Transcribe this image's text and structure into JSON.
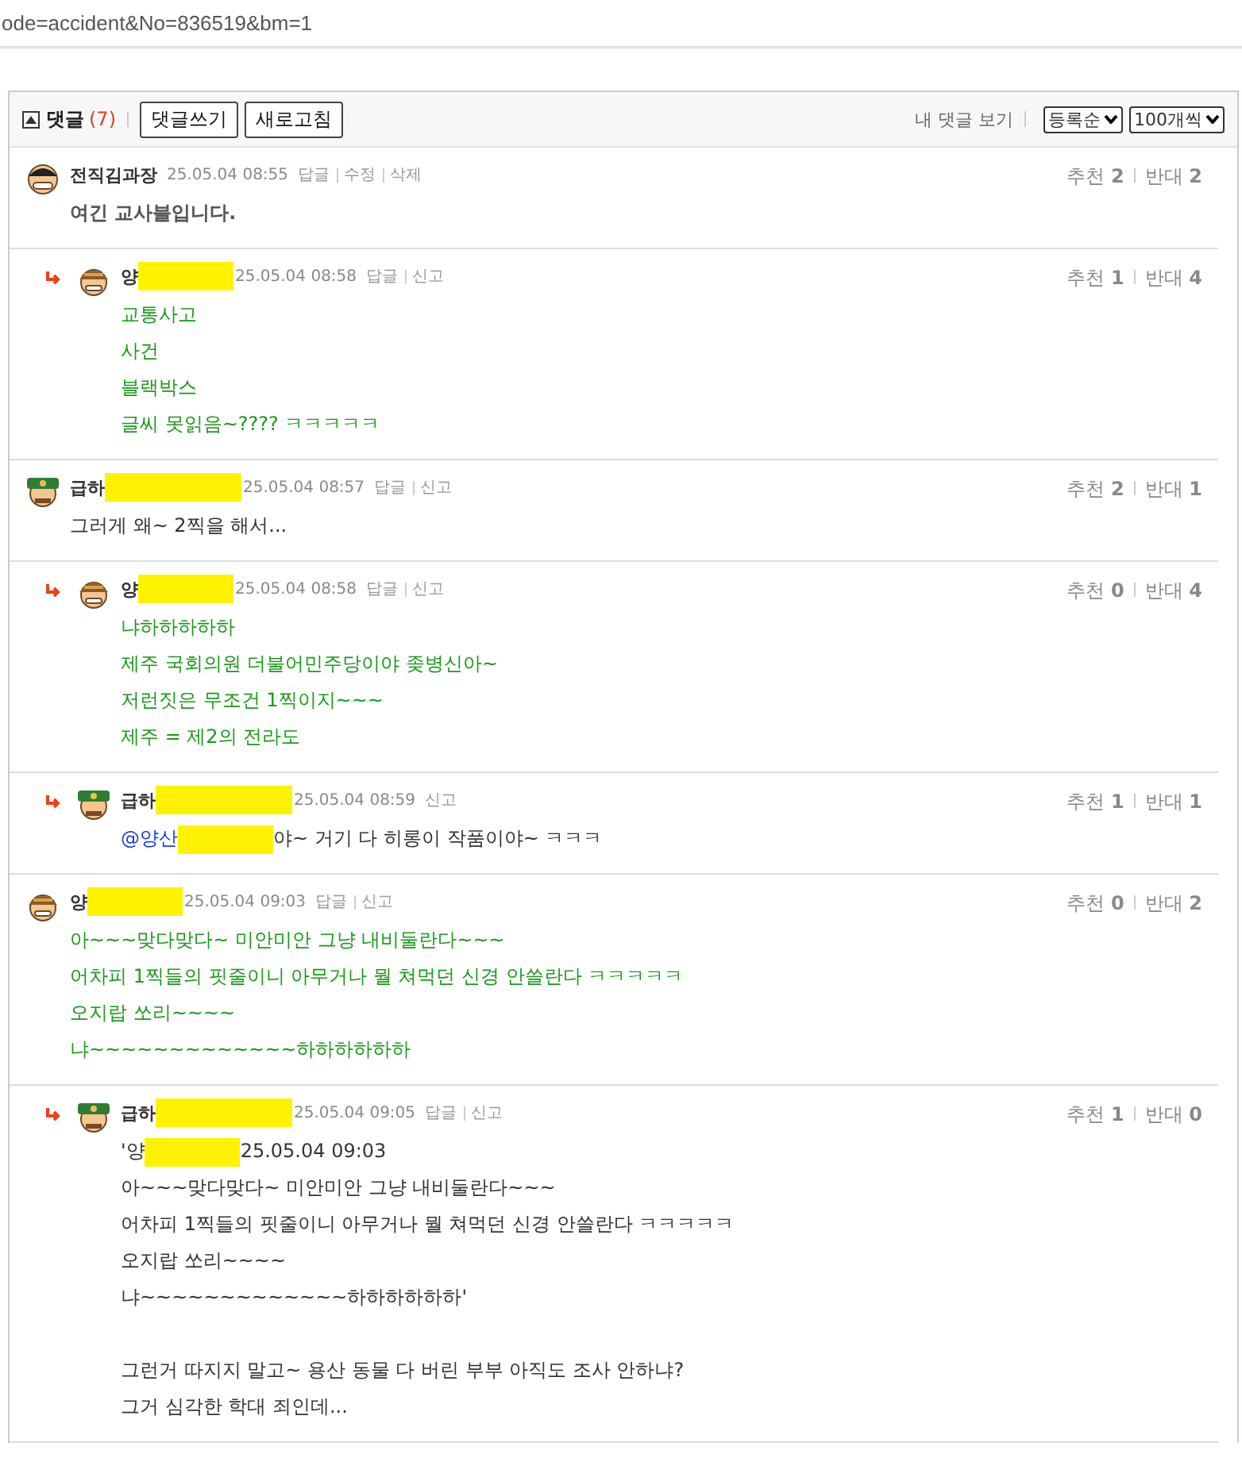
{
  "address_bar": {
    "url": "ode=accident&No=836519&bm=1"
  },
  "comments_header": {
    "title": "댓글",
    "count": "(7)",
    "buttons": [
      "댓글쓰기",
      "새로고침"
    ],
    "my_comments_link": "내 댓글 보기",
    "sort_select": "등록순",
    "page_size_select": "100개씩"
  },
  "comments": [
    {
      "reply": false,
      "avatar": {
        "kind": "helmet"
      },
      "author": "전직김과장",
      "redacted": false,
      "time": "25.05.04 08:55",
      "actions": [
        "답글",
        "수정",
        "삭제"
      ],
      "body": {
        "kind": "emphasis"
      },
      "paragraphs": [
        [
          [
            {
              "kind": "text",
              "text": "여긴 교사블입니다."
            }
          ]
        ]
      ],
      "up_label": "추천",
      "up": "2",
      "down_label": "반대",
      "down": "2"
    },
    {
      "reply": true,
      "avatar": {
        "kind": "cap"
      },
      "author": "양",
      "redacted": true,
      "time": "25.05.04 08:58",
      "actions": [
        "답글",
        "신고"
      ],
      "body": {
        "kind": "highlight"
      },
      "paragraphs": [
        [
          [
            {
              "kind": "text",
              "text": "교통사고"
            }
          ],
          [
            {
              "kind": "text",
              "text": "사건"
            }
          ],
          [
            {
              "kind": "text",
              "text": "블랙박스"
            }
          ],
          [
            {
              "kind": "text",
              "text": "글씨 못읽음~???? ㅋㅋㅋㅋㅋ"
            }
          ]
        ]
      ],
      "up_label": "추천",
      "up": "1",
      "down_label": "반대",
      "down": "4"
    },
    {
      "reply": false,
      "avatar": {
        "kind": "officer"
      },
      "author": "급하",
      "redacted": true,
      "time": "25.05.04 08:57",
      "actions": [
        "답글",
        "신고"
      ],
      "body": {
        "kind": "normal"
      },
      "paragraphs": [
        [
          [
            {
              "kind": "text",
              "text": "그러게 왜~ 2찍을 해서..."
            }
          ]
        ]
      ],
      "up_label": "추천",
      "up": "2",
      "down_label": "반대",
      "down": "1"
    },
    {
      "reply": true,
      "avatar": {
        "kind": "cap"
      },
      "author": "양",
      "redacted": true,
      "time": "25.05.04 08:58",
      "actions": [
        "답글",
        "신고"
      ],
      "body": {
        "kind": "highlight"
      },
      "paragraphs": [
        [
          [
            {
              "kind": "text",
              "text": "냐하하하하하"
            }
          ],
          [
            {
              "kind": "text",
              "text": "제주 국회의원 더불어민주당이야 좆병신아~"
            }
          ],
          [
            {
              "kind": "text",
              "text": "저런짓은 무조건 1찍이지~~~"
            }
          ],
          [
            {
              "kind": "text",
              "text": "제주 = 제2의 전라도"
            }
          ]
        ]
      ],
      "up_label": "추천",
      "up": "0",
      "down_label": "반대",
      "down": "4"
    },
    {
      "reply": true,
      "avatar": {
        "kind": "officer"
      },
      "author": "급하",
      "redacted": true,
      "time": "25.05.04 08:59",
      "actions": [
        "신고"
      ],
      "body": {
        "kind": "normal"
      },
      "paragraphs": [
        [
          [
            {
              "kind": "mention",
              "text": "@양산"
            },
            {
              "kind": "redaction"
            },
            {
              "kind": "text",
              "text": "야~ 거기 다 히롱이 작품이야~ ㅋㅋㅋ"
            }
          ]
        ]
      ],
      "up_label": "추천",
      "up": "1",
      "down_label": "반대",
      "down": "1"
    },
    {
      "reply": false,
      "avatar": {
        "kind": "cap"
      },
      "author": "양",
      "redacted": true,
      "time": "25.05.04 09:03",
      "actions": [
        "답글",
        "신고"
      ],
      "body": {
        "kind": "highlight"
      },
      "paragraphs": [
        [
          [
            {
              "kind": "text",
              "text": "아~~~맞다맞다~ 미안미안 그냥 내비둘란다~~~"
            }
          ],
          [
            {
              "kind": "text",
              "text": "어차피 1찍들의 핏줄이니 아무거나 뭘 쳐먹던 신경 안쓸란다 ㅋㅋㅋㅋㅋ"
            }
          ],
          [
            {
              "kind": "text",
              "text": "오지랍 쏘리~~~~"
            }
          ],
          [
            {
              "kind": "text",
              "text": "냐~~~~~~~~~~~~~하하하하하하"
            }
          ]
        ]
      ],
      "up_label": "추천",
      "up": "0",
      "down_label": "반대",
      "down": "2"
    },
    {
      "reply": true,
      "avatar": {
        "kind": "officer"
      },
      "author": "급하",
      "redacted": true,
      "time": "25.05.04 09:05",
      "actions": [
        "답글",
        "신고"
      ],
      "body": {
        "kind": "normal"
      },
      "paragraphs": [
        [
          [
            {
              "kind": "text",
              "text": "'양"
            },
            {
              "kind": "redaction"
            },
            {
              "kind": "text",
              "text": "25.05.04 09:03"
            }
          ],
          [
            {
              "kind": "text",
              "text": "아~~~맞다맞다~ 미안미안 그냥 내비둘란다~~~"
            }
          ],
          [
            {
              "kind": "text",
              "text": "어차피 1찍들의 핏줄이니 아무거나 뭘 쳐먹던 신경 안쓸란다 ㅋㅋㅋㅋㅋ"
            }
          ],
          [
            {
              "kind": "text",
              "text": "오지랍 쏘리~~~~"
            }
          ],
          [
            {
              "kind": "text",
              "text": "냐~~~~~~~~~~~~~하하하하하하'"
            }
          ]
        ],
        [
          [
            {
              "kind": "text",
              "text": "그런거 따지지 말고~ 용산 동물 다 버린 부부 아직도 조사 안하냐?"
            }
          ],
          [
            {
              "kind": "text",
              "text": "그거 심각한 학대 죄인데..."
            }
          ]
        ]
      ],
      "up_label": "추천",
      "up": "1",
      "down_label": "반대",
      "down": "0"
    }
  ]
}
